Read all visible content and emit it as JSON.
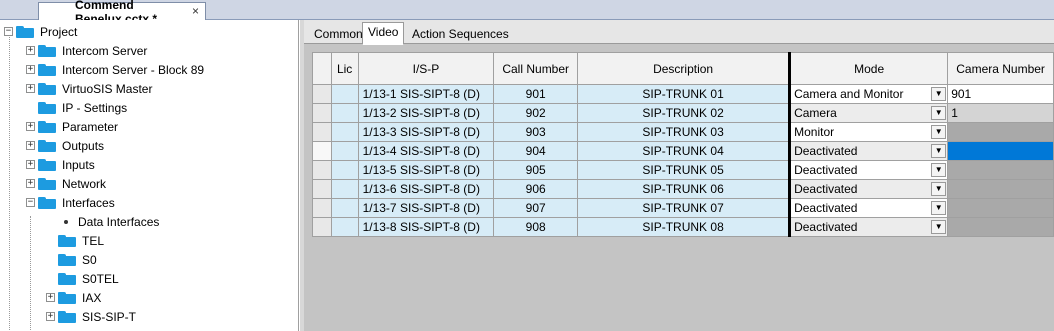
{
  "document_tab": {
    "title": "Commend Benelux.cctx *",
    "close": "×"
  },
  "tree": {
    "root": "Project",
    "items": [
      "Intercom Server",
      "Intercom Server - Block 89",
      "VirtuoSIS Master",
      "IP - Settings",
      "Parameter",
      "Outputs",
      "Inputs",
      "Network",
      "Interfaces",
      "Data Interfaces",
      "TEL",
      "S0",
      "S0TEL",
      "IAX",
      "SIS-SIP-T"
    ]
  },
  "subtabs": [
    "Common",
    "Video",
    "Action Sequences"
  ],
  "active_subtab": "Video",
  "grid": {
    "columns": [
      "Lic",
      "I/S-P",
      "Call Number",
      "Description",
      "Mode",
      "Camera Number"
    ],
    "rows": [
      {
        "isp": "1/13-1  SIS-SIPT-8 (D)",
        "call": "901",
        "desc": "SIP-TRUNK 01",
        "mode": "Camera and Monitor",
        "camera": "901"
      },
      {
        "isp": "1/13-2  SIS-SIPT-8 (D)",
        "call": "902",
        "desc": "SIP-TRUNK 02",
        "mode": "Camera",
        "camera": "1"
      },
      {
        "isp": "1/13-3  SIS-SIPT-8 (D)",
        "call": "903",
        "desc": "SIP-TRUNK 03",
        "mode": "Monitor",
        "camera": ""
      },
      {
        "isp": "1/13-4  SIS-SIPT-8 (D)",
        "call": "904",
        "desc": "SIP-TRUNK 04",
        "mode": "Deactivated",
        "camera": ""
      },
      {
        "isp": "1/13-5  SIS-SIPT-8 (D)",
        "call": "905",
        "desc": "SIP-TRUNK 05",
        "mode": "Deactivated",
        "camera": ""
      },
      {
        "isp": "1/13-6  SIS-SIPT-8 (D)",
        "call": "906",
        "desc": "SIP-TRUNK 06",
        "mode": "Deactivated",
        "camera": ""
      },
      {
        "isp": "1/13-7  SIS-SIPT-8 (D)",
        "call": "907",
        "desc": "SIP-TRUNK 07",
        "mode": "Deactivated",
        "camera": ""
      },
      {
        "isp": "1/13-8  SIS-SIPT-8 (D)",
        "call": "908",
        "desc": "SIP-TRUNK 08",
        "mode": "Deactivated",
        "camera": ""
      }
    ]
  },
  "colors": {
    "folder": "#1d9be0",
    "cell_blue": "#d7ecf7",
    "selection": "#0078d7"
  }
}
